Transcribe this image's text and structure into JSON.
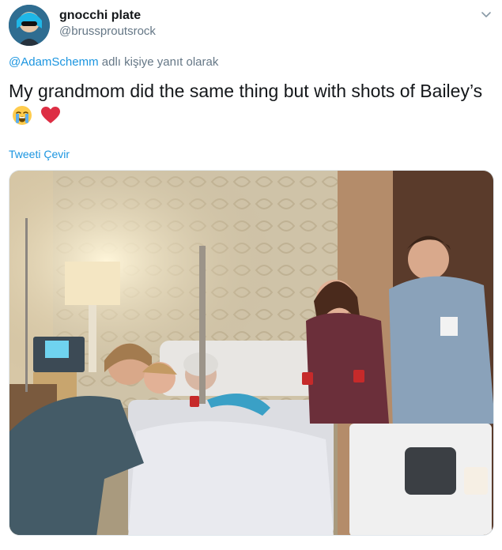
{
  "tweet": {
    "author": {
      "display_name": "gnocchi plate",
      "handle": "@brussproutsrock"
    },
    "reply_to": {
      "mention": "@AdamSchemm",
      "suffix": " adlı kişiye yanıt olarak"
    },
    "text": "My grandmom did the same thing but with shots of Bailey’s",
    "emojis": [
      "loudly-crying-face-icon",
      "red-heart-icon"
    ],
    "translate_label": "Tweeti Çevir",
    "media": {
      "type": "photo",
      "subject": "hospital room"
    }
  },
  "icons": {
    "menu": "chevron-down-icon"
  },
  "colors": {
    "link": "#1b95e0",
    "secondary_text": "#657786",
    "primary_text": "#14171a",
    "heart": "#e0245e"
  }
}
